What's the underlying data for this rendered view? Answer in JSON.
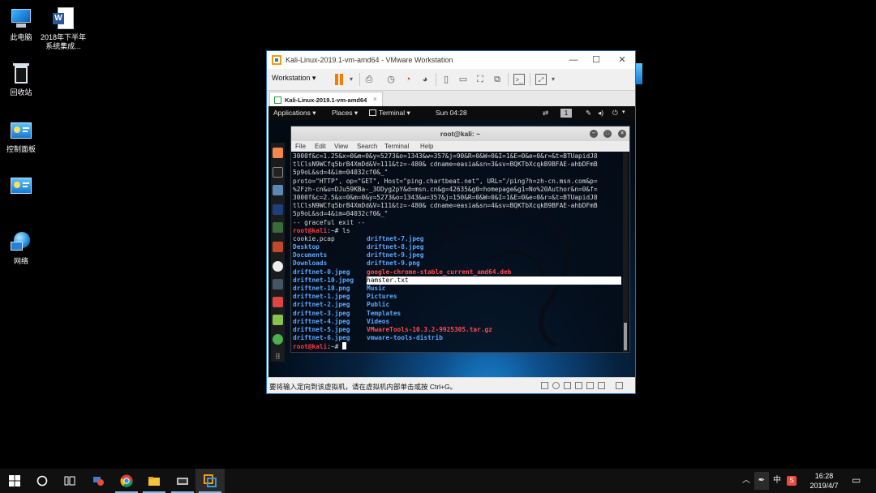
{
  "desktop": {
    "icons": [
      {
        "label": "此电脑"
      },
      {
        "label": "2018年下半年系统集成..."
      },
      {
        "label": "回收站"
      },
      {
        "label": "控制面板"
      },
      {
        "label": ""
      },
      {
        "label": "网络"
      }
    ]
  },
  "vmware": {
    "title": "Kali-Linux-2019.1-vm-amd64 - VMware Workstation",
    "menu_label": "Workstation ▾",
    "tab_label": "Kali-Linux-2019.1-vm-amd64",
    "status_message": "要将输入定向到该虚拟机，请在虚拟机内部单击或按 Ctrl+G。"
  },
  "kali": {
    "topbar": {
      "applications": "Applications ▾",
      "places": "Places ▾",
      "terminal": "Terminal ▾",
      "clock": "Sun 04:28",
      "workspace": "1"
    },
    "terminal": {
      "title": "root@kali: ~",
      "menu": [
        "File",
        "Edit",
        "View",
        "Search",
        "Terminal",
        "Help"
      ],
      "log_lines": [
        "3000f&c=1.25&x=0&m=0&y=5273&o=1343&w=357&j=90&R=0&W=0&I=1&E=0&e=0&r=&t=BTUapidJ8",
        "tlClsN9WCfq5brB4XmDd&V=111&tz=-480& cdname=easia&sn=3&sv=BQKTbXcqkB9BFAE-ahbDFmB",
        "5p9oL&sd=4&im=04032cf0&_\"",
        "proto=\"HTTP\", op=\"GET\", Host=\"ping.chartbeat.net\", URL=\"/ping?h=zh-cn.msn.com&p=",
        "%2Fzh-cn&u=DJu59KBa-_3ODyg2pY&d=msn.cn&g=42635&g0=homepage&g1=No%20Author&n=0&f=",
        "3000f&c=2.5&x=0&m=0&y=5273&o=1343&w=357&j=150&R=0&W=0&I=1&E=0&e=0&r=&t=BTUapidJ8",
        "tlClsN9WCfq5brB4XmDd&V=111&tz=-480& cdname=easia&sn=4&sv=BQKTbXcqkB9BFAE-ahbDFmB",
        "5p9oL&sd=4&im=04032cf0&_\"",
        "-- graceful exit --"
      ],
      "prompt": "root@kali",
      "prompt_suffix": ":~# ",
      "command": "ls",
      "ls_rows": [
        [
          {
            "t": "cookie.pcap",
            "c": "plain"
          },
          {
            "t": "driftnet-7.jpeg",
            "c": "blue"
          }
        ],
        [
          {
            "t": "Desktop",
            "c": "blue"
          },
          {
            "t": "driftnet-8.jpeg",
            "c": "blue"
          }
        ],
        [
          {
            "t": "Documents",
            "c": "blue"
          },
          {
            "t": "driftnet-9.jpeg",
            "c": "blue"
          }
        ],
        [
          {
            "t": "Downloads",
            "c": "blue"
          },
          {
            "t": "driftnet-9.png",
            "c": "blue"
          }
        ],
        [
          {
            "t": "driftnet-0.jpeg",
            "c": "blue"
          },
          {
            "t": "google-chrome-stable_current_amd64.deb",
            "c": "red"
          }
        ],
        [
          {
            "t": "driftnet-10.jpeg",
            "c": "blue"
          },
          {
            "t": "hamster.txt",
            "c": "hl"
          }
        ],
        [
          {
            "t": "driftnet-10.png",
            "c": "blue"
          },
          {
            "t": "Music",
            "c": "blue"
          }
        ],
        [
          {
            "t": "driftnet-1.jpeg",
            "c": "blue"
          },
          {
            "t": "Pictures",
            "c": "blue"
          }
        ],
        [
          {
            "t": "driftnet-2.jpeg",
            "c": "blue"
          },
          {
            "t": "Public",
            "c": "blue"
          }
        ],
        [
          {
            "t": "driftnet-3.jpeg",
            "c": "blue"
          },
          {
            "t": "Templates",
            "c": "blue"
          }
        ],
        [
          {
            "t": "driftnet-4.jpeg",
            "c": "blue"
          },
          {
            "t": "Videos",
            "c": "blue"
          }
        ],
        [
          {
            "t": "driftnet-5.jpeg",
            "c": "blue"
          },
          {
            "t": "VMwareTools-10.3.2-9925305.tar.gz",
            "c": "red"
          }
        ],
        [
          {
            "t": "driftnet-6.jpeg",
            "c": "blue"
          },
          {
            "t": "vmware-tools-distrib",
            "c": "blue"
          }
        ]
      ]
    }
  },
  "taskbar": {
    "ime": "中",
    "time": "16:28",
    "date": "2019/4/7"
  },
  "colors": {
    "taskbar_bg": "#101010",
    "prompt": "#ff3b3b",
    "dir": "#5ca7ff",
    "archive": "#ff4d4d",
    "vmware_accent": "#1e6fc4"
  }
}
